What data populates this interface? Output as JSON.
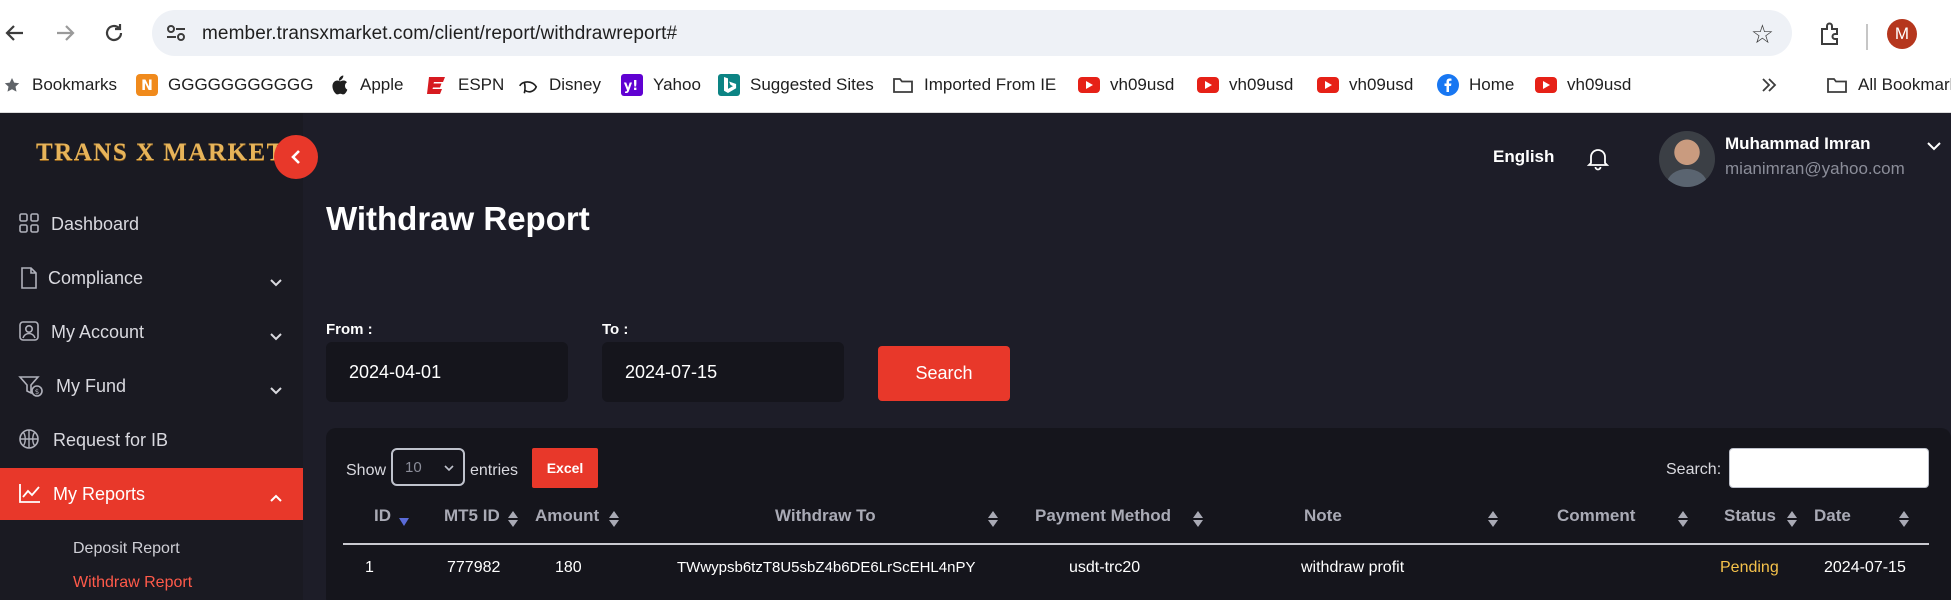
{
  "browser": {
    "url": "member.transxmarket.com/client/report/withdrawreport#",
    "profile_initial": "M",
    "bookmarks": [
      {
        "label": "Bookmarks",
        "icon": "star-icon"
      },
      {
        "label": "GGGGGGGGGGG",
        "icon": "n-app-icon"
      },
      {
        "label": "Apple",
        "icon": "apple-icon"
      },
      {
        "label": "ESPN",
        "icon": "espn-icon"
      },
      {
        "label": "Disney",
        "icon": "disney-icon"
      },
      {
        "label": "Yahoo",
        "icon": "yahoo-icon"
      },
      {
        "label": "Suggested Sites",
        "icon": "bing-icon"
      },
      {
        "label": "Imported From IE",
        "icon": "folder-icon"
      },
      {
        "label": "vh09usd",
        "icon": "youtube-icon"
      },
      {
        "label": "vh09usd",
        "icon": "youtube-icon"
      },
      {
        "label": "vh09usd",
        "icon": "youtube-icon"
      },
      {
        "label": "Home",
        "icon": "facebook-icon"
      },
      {
        "label": "vh09usd",
        "icon": "youtube-icon"
      }
    ],
    "all_bookmarks": "All Bookmarks"
  },
  "brand": {
    "logo_text": "TRANS X MARKETS",
    "accent": "#e8382a",
    "logo_color": "#e7b45a"
  },
  "sidebar": {
    "items": [
      {
        "label": "Dashboard",
        "icon": "dashboard-icon"
      },
      {
        "label": "Compliance",
        "icon": "document-icon"
      },
      {
        "label": "My Account",
        "icon": "account-icon"
      },
      {
        "label": "My Fund",
        "icon": "fund-icon"
      },
      {
        "label": "Request for IB",
        "icon": "basketball-icon"
      },
      {
        "label": "My Reports",
        "icon": "chart-icon"
      }
    ],
    "sub_items": [
      {
        "label": "Deposit Report"
      },
      {
        "label": "Withdraw Report"
      }
    ]
  },
  "header": {
    "language": "English",
    "user_name": "Muhammad Imran",
    "user_email": "mianimran@yahoo.com"
  },
  "page": {
    "title": "Withdraw Report",
    "from_label": "From :",
    "from_value": "2024-04-01",
    "to_label": "To :",
    "to_value": "2024-07-15",
    "search_button": "Search"
  },
  "table": {
    "show_label": "Show",
    "entries_value": "10",
    "entries_label": "entries",
    "excel_button": "Excel",
    "search_label": "Search:",
    "columns": [
      "ID",
      "MT5 ID",
      "Amount",
      "Withdraw To",
      "Payment Method",
      "Note",
      "Comment",
      "Status",
      "Date"
    ],
    "rows": [
      {
        "id": "1",
        "mt5_id": "777982",
        "amount": "180",
        "withdraw_to": "TWwypsb6tzT8U5sbZ4b6DE6LrScEHL4nPY",
        "payment_method": "usdt-trc20",
        "note": "withdraw profit",
        "comment": "",
        "status": "Pending",
        "date": "2024-07-15"
      }
    ],
    "status_pending_color": "#f5c24b"
  }
}
